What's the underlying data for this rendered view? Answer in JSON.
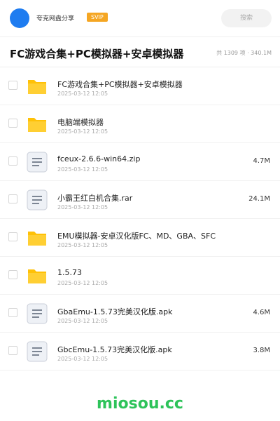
{
  "header": {
    "user_name": "夸克网盘分享",
    "badge": "SVIP",
    "search_label": "搜索"
  },
  "folder": {
    "title": "FC游戏合集+PC模拟器+安卓模拟器",
    "stats": "共 1309 项 · 340.1M"
  },
  "files": [
    {
      "name": "FC游戏合集+PC模拟器+安卓模拟器",
      "date": "2025-03-12 12:05",
      "size": "",
      "icon": "folder-icon"
    },
    {
      "name": "电脑端模拟器",
      "date": "2025-03-12 12:05",
      "size": "",
      "icon": "folder-icon"
    },
    {
      "name": "fceux-2.6.6-win64.zip",
      "date": "2025-03-12 12:05",
      "size": "4.7M",
      "icon": "document-icon"
    },
    {
      "name": "小霸王红白机合集.rar",
      "date": "2025-03-12 12:05",
      "size": "24.1M",
      "icon": "document-icon"
    },
    {
      "name": "EMU模拟器-安卓汉化版FC、MD、GBA、SFC",
      "date": "2025-03-12 12:05",
      "size": "",
      "icon": "folder-icon"
    },
    {
      "name": "1.5.73",
      "date": "2025-03-12 12:05",
      "size": "",
      "icon": "folder-icon"
    },
    {
      "name": "GbaEmu-1.5.73完美汉化版.apk",
      "date": "2025-03-12 12:05",
      "size": "4.6M",
      "icon": "document-icon"
    },
    {
      "name": "GbcEmu-1.5.73完美汉化版.apk",
      "date": "2025-03-12 12:05",
      "size": "3.8M",
      "icon": "document-icon"
    }
  ],
  "footer": {
    "logo_text": "miosou.cc"
  },
  "colors": {
    "accent": "#1e7cf0",
    "svip": "#f5a623",
    "folder": "#ffc107",
    "logo": "#2ec35a"
  }
}
